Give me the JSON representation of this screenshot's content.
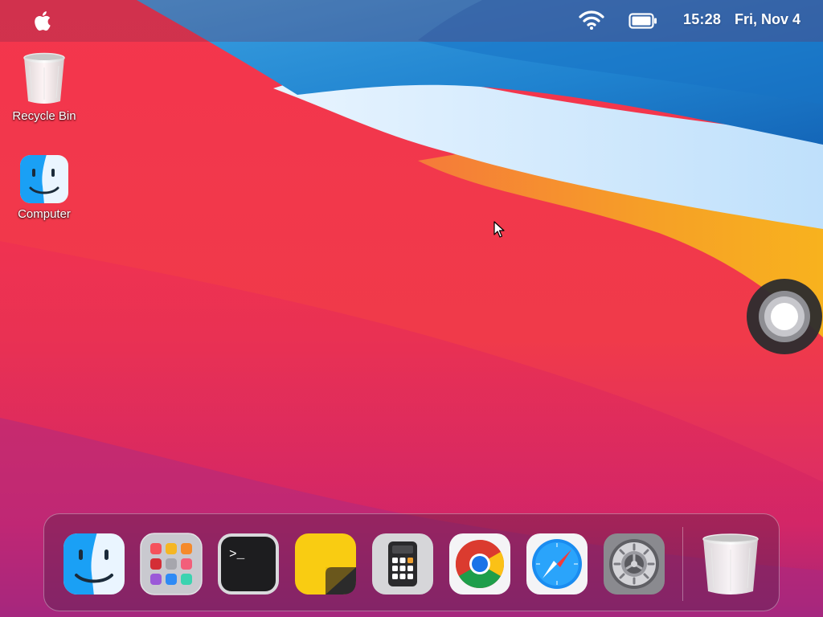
{
  "menubar": {
    "apple_icon": "apple-icon",
    "wifi_icon": "wifi-icon",
    "battery_icon": "battery-icon",
    "time": "15:28",
    "date": "Fri, Nov 4"
  },
  "desktop_icons": [
    {
      "label": "Recycle Bin",
      "icon": "trash-icon"
    },
    {
      "label": "Computer",
      "icon": "finder-icon"
    }
  ],
  "dock": {
    "items": [
      {
        "app": "Finder",
        "icon": "finder-icon"
      },
      {
        "app": "Launchpad",
        "icon": "launchpad-icon"
      },
      {
        "app": "Terminal",
        "icon": "terminal-icon",
        "prompt": ">_"
      },
      {
        "app": "Notes",
        "icon": "notes-icon"
      },
      {
        "app": "Calculator",
        "icon": "calculator-icon"
      },
      {
        "app": "Chrome",
        "icon": "chrome-icon"
      },
      {
        "app": "Safari",
        "icon": "safari-icon"
      },
      {
        "app": "System Preferences",
        "icon": "gear-icon"
      },
      {
        "app": "Trash",
        "icon": "trash-icon"
      }
    ]
  },
  "colors": {
    "accent_red": "#f0334c",
    "accent_blue": "#1e88d8",
    "accent_orange": "#f5a020"
  }
}
